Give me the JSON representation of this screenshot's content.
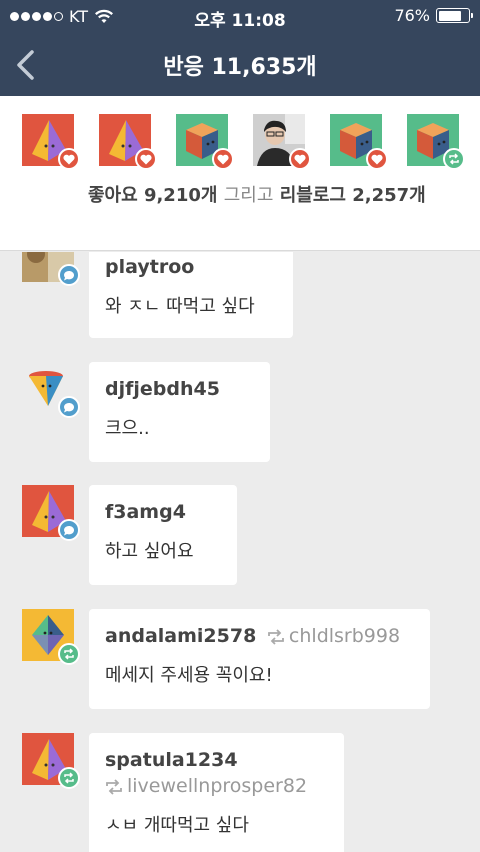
{
  "status_bar": {
    "carrier": "KT",
    "time": "오후 11:08",
    "battery": "76%",
    "battery_level": 0.76
  },
  "nav": {
    "title": "반응 11,635개"
  },
  "reactors": {
    "summary_likes": "좋아요 9,210개",
    "summary_and": "그리고",
    "summary_reblogs": "리블로그 2,257개",
    "avatars": [
      {
        "icon": "pyramid-avatar-icon",
        "badge": "heart-icon"
      },
      {
        "icon": "pyramid-avatar-icon",
        "badge": "heart-icon"
      },
      {
        "icon": "cube-avatar-icon",
        "badge": "heart-icon"
      },
      {
        "icon": "photo-avatar-icon",
        "badge": "heart-icon"
      },
      {
        "icon": "cube-avatar-icon",
        "badge": "heart-icon"
      },
      {
        "icon": "cube-avatar-icon",
        "badge": "reblog-icon"
      }
    ]
  },
  "notes": [
    {
      "user": "playtroo",
      "text": "와 ㅈㄴ 따먹고 싶다",
      "badge": "reply-icon"
    },
    {
      "user": "djfjebdh45",
      "text": "크으..",
      "badge": "reply-icon"
    },
    {
      "user": "f3amg4",
      "text": "하고 싶어요",
      "badge": "reply-icon"
    },
    {
      "user": "andalami2578",
      "via": "chldlsrb998",
      "text": "메세지 주세용 꼭이요!",
      "badge": "reblog-icon"
    },
    {
      "user": "spatula1234",
      "via": "livewellnprosper82",
      "text": "ㅅㅂ 개따먹고 싶다",
      "badge": "reblog-icon"
    }
  ],
  "colors": {
    "header": "#36465d",
    "like": "#e0553f",
    "reblog": "#56bc8a",
    "reply": "#529ecc"
  }
}
